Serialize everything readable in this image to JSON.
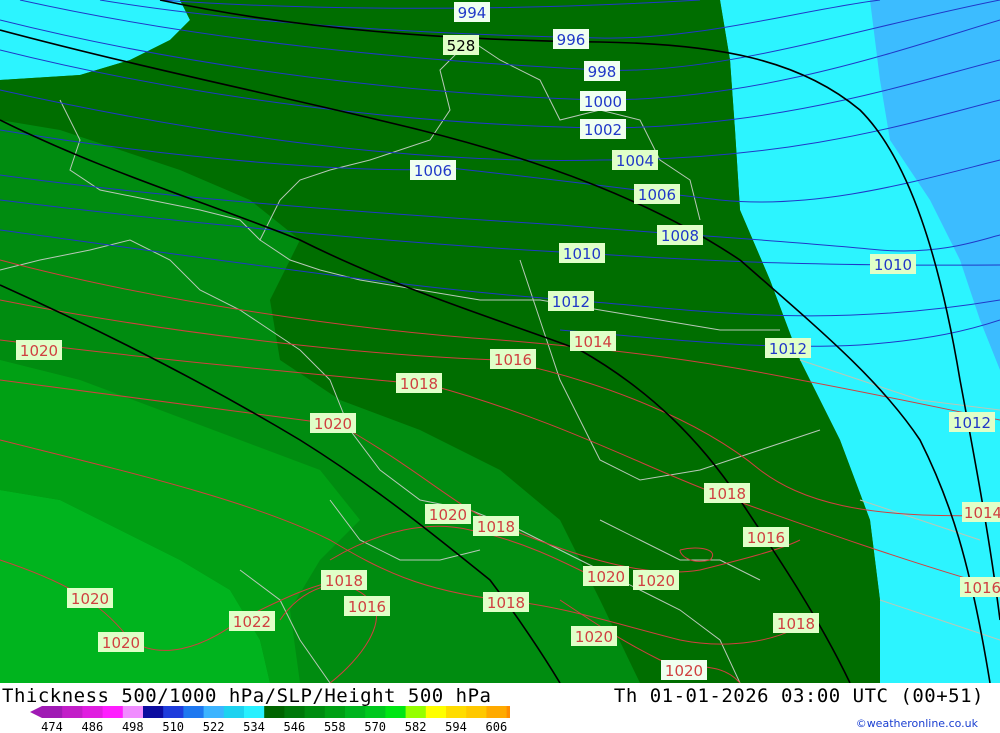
{
  "title": "Thickness 500/1000 hPa/SLP/Height 500 hPa",
  "datetime": "Th 01-01-2026 03:00 UTC (00+51)",
  "credit": "©weatheronline.co.uk",
  "legend": {
    "ticks": [
      "474",
      "486",
      "498",
      "510",
      "522",
      "534",
      "546",
      "558",
      "570",
      "582",
      "594",
      "606"
    ],
    "colors": [
      "#a01ab4",
      "#c21ec8",
      "#e01ee0",
      "#ff1eff",
      "#f08cff",
      "#0c0ca0",
      "#1e3cdc",
      "#1e78f0",
      "#3cb4ff",
      "#1ed2f0",
      "#28f0ff",
      "#006400",
      "#00780a",
      "#008c10",
      "#00a014",
      "#00b41e",
      "#00c81e",
      "#00e614",
      "#96ff00",
      "#ffff00",
      "#ffdc00",
      "#ffc800",
      "#ffaa00",
      "#ff8c00",
      "#ff6e00"
    ]
  },
  "map": {
    "zone_colors": {
      "blue_strong": "#3cbcff",
      "cyan": "#2cf4ff",
      "green_dark": "#006e00",
      "green_mid": "#008c10",
      "green_light": "#00a014",
      "green_lighter": "#00b41e"
    },
    "isobar_colors": {
      "blue": "#2038c8",
      "red": "#d04040",
      "black": "#000000"
    },
    "height_labels": [
      {
        "text": "528",
        "color": "#e0ffc8"
      }
    ],
    "isobar_labels_blue": [
      "994",
      "996",
      "998",
      "1000",
      "1002",
      "1004",
      "1006",
      "1006",
      "1008",
      "1010",
      "1010",
      "1012",
      "1012"
    ],
    "isobar_labels_red": [
      "1020",
      "1014",
      "1016",
      "1018",
      "1020",
      "1018",
      "1016",
      "1020",
      "1018",
      "1020",
      "1020",
      "1018",
      "1016",
      "1022",
      "1018",
      "1020",
      "1020",
      "1020",
      "1018",
      "1012",
      "1014",
      "1016"
    ]
  }
}
